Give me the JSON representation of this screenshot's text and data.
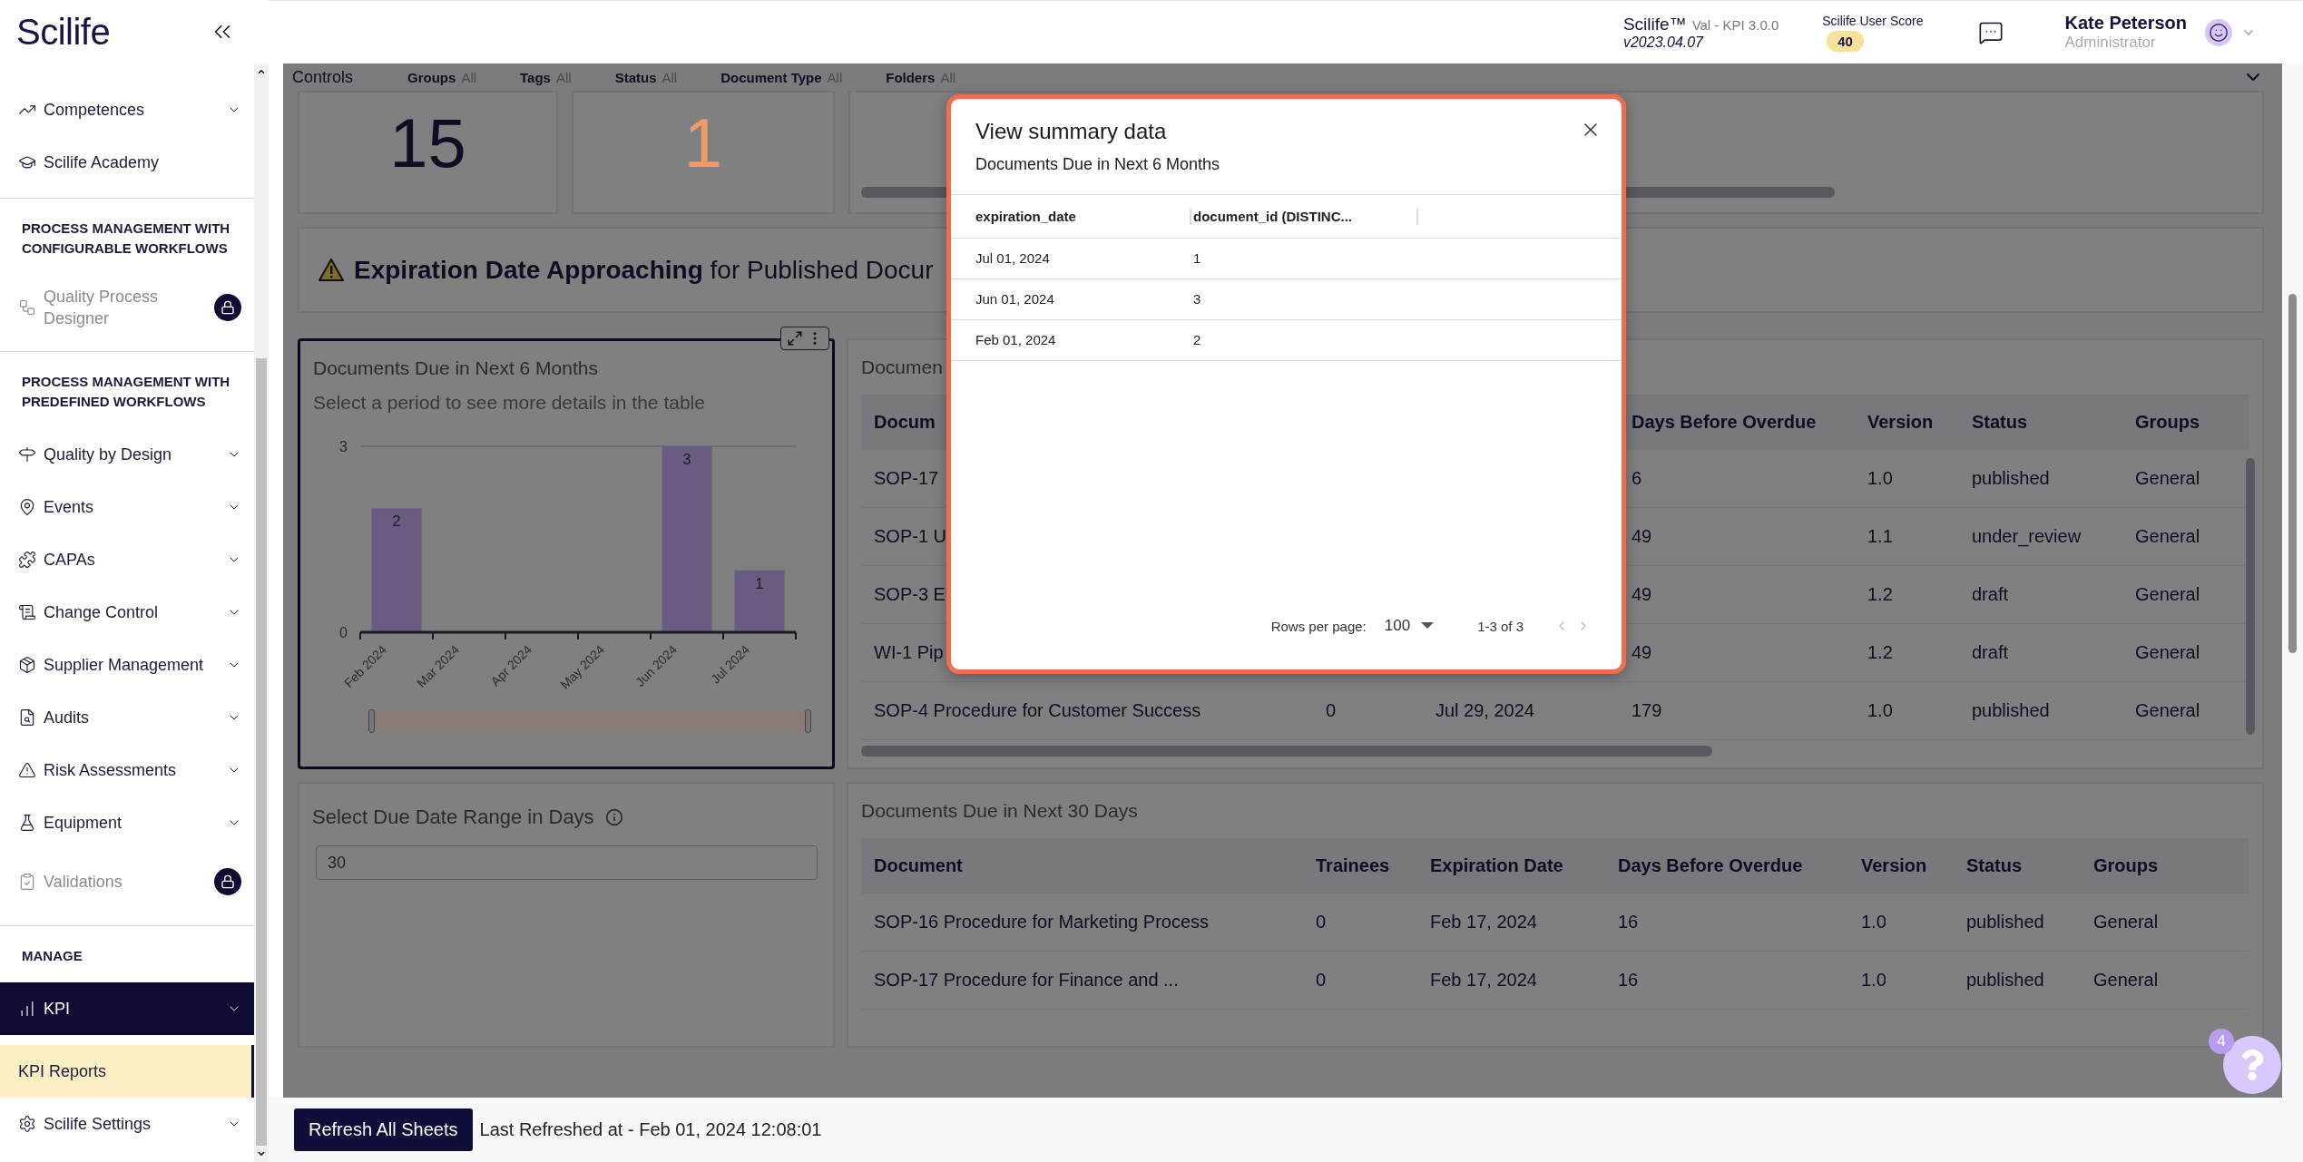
{
  "sidebar": {
    "logo": "Scilife",
    "groups": [
      {
        "items": [
          {
            "label": "Competences",
            "kind": "item",
            "selected": false,
            "expandable": true
          },
          {
            "label": "Scilife Academy",
            "kind": "item",
            "selected": false,
            "expandable": false
          }
        ]
      },
      {
        "heading": "PROCESS MANAGEMENT WITH CONFIGURABLE WORKFLOWS",
        "items": [
          {
            "label": "Quality Process Designer",
            "kind": "locked",
            "selected": false,
            "expandable": false
          }
        ]
      },
      {
        "heading": "PROCESS MANAGEMENT WITH PREDEFINED WORKFLOWS",
        "items": [
          {
            "label": "Quality by Design",
            "kind": "item",
            "selected": false,
            "expandable": true
          },
          {
            "label": "Events",
            "kind": "item",
            "selected": false,
            "expandable": true
          },
          {
            "label": "CAPAs",
            "kind": "item",
            "selected": false,
            "expandable": true
          },
          {
            "label": "Change Control",
            "kind": "item",
            "selected": false,
            "expandable": true
          },
          {
            "label": "Supplier Management",
            "kind": "item",
            "selected": false,
            "expandable": true
          },
          {
            "label": "Audits",
            "kind": "item",
            "selected": false,
            "expandable": true
          },
          {
            "label": "Risk Assessments",
            "kind": "item",
            "selected": false,
            "expandable": true
          },
          {
            "label": "Equipment",
            "kind": "item",
            "selected": false,
            "expandable": true
          },
          {
            "label": "Validations",
            "kind": "locked",
            "selected": false,
            "expandable": false
          }
        ]
      },
      {
        "heading": "MANAGE",
        "items": [
          {
            "label": "KPI",
            "kind": "item",
            "selected": true,
            "expandable": true
          },
          {
            "label": "KPI Reports",
            "kind": "sub",
            "selected": true,
            "expandable": false
          },
          {
            "label": "Scilife Settings",
            "kind": "item",
            "selected": false,
            "expandable": true
          }
        ]
      }
    ]
  },
  "header": {
    "product": "Scilife™",
    "edition": "Val - KPI 3.0.0",
    "version": "v2023.04.07",
    "score_label": "Scilife User Score",
    "score": "40",
    "user_name": "Kate Peterson",
    "user_role": "Administrator"
  },
  "controls": {
    "title": "Controls",
    "filters": [
      {
        "label": "Groups",
        "value": "All"
      },
      {
        "label": "Tags",
        "value": "All"
      },
      {
        "label": "Status",
        "value": "All"
      },
      {
        "label": "Document Type",
        "value": "All"
      },
      {
        "label": "Folders",
        "value": "All"
      }
    ]
  },
  "kpi_cards": [
    {
      "kind": "number",
      "value": "15",
      "color": "#0e0d24"
    },
    {
      "kind": "number",
      "value": "1",
      "color": "#f09a66"
    },
    {
      "kind": "scroll"
    }
  ],
  "banner": {
    "text": "**Expiration Date Approaching** for Published Docur"
  },
  "chart_card": {
    "title": "Documents Due in Next 6 Months",
    "subtitle": "Select a period to see more details in the table",
    "focused": true,
    "chart_data": {
      "type": "bar",
      "categories": [
        "Feb 2024",
        "Mar 2024",
        "Apr 2024",
        "May 2024",
        "Jun 2024",
        "Jul 2024"
      ],
      "series": [
        {
          "color": "#6a5c80",
          "values": [
            2,
            0,
            0,
            0,
            3,
            1
          ]
        }
      ],
      "ylim": [
        0,
        3
      ],
      "yticks": [
        0,
        3
      ],
      "value_labels": [
        "2",
        null,
        null,
        null,
        "3",
        "1"
      ]
    }
  },
  "range_card": {
    "title": "Select Due Date Range in Days",
    "value": "30"
  },
  "tables": [
    {
      "title": "Documen",
      "columns": [
        "Docum",
        null,
        null,
        "Days Before Overdue",
        "Version",
        "Status",
        "Groups"
      ],
      "rows": [
        [
          "SOP-17",
          null,
          null,
          "6",
          "1.0",
          "published",
          "General"
        ],
        [
          "SOP-1 U",
          null,
          null,
          "49",
          "1.1",
          "under_review",
          "General"
        ],
        [
          "SOP-3 E",
          null,
          null,
          "49",
          "1.2",
          "draft",
          "General"
        ],
        [
          "WI-1 Pip",
          null,
          null,
          "49",
          "1.2",
          "draft",
          "General"
        ],
        [
          "SOP-4 Procedure for Customer Success",
          "0",
          "Jul 29, 2024",
          "179",
          "1.0",
          "published",
          "General"
        ]
      ]
    },
    {
      "title": "Documents Due in Next 30 Days",
      "columns": [
        "Document",
        "Trainees",
        "Expiration Date",
        "Days Before Overdue",
        "Version",
        "Status",
        "Groups"
      ],
      "rows": [
        [
          "SOP-16 Procedure for Marketing Process",
          "0",
          "Feb 17, 2024",
          "16",
          "1.0",
          "published",
          "General"
        ],
        [
          "SOP-17 Procedure for Finance and ...",
          "0",
          "Feb 17, 2024",
          "16",
          "1.0",
          "published",
          "General"
        ]
      ]
    }
  ],
  "footer": {
    "button": "Refresh All Sheets",
    "status": "Last Refreshed at - Feb 01, 2024 12:08:01"
  },
  "help": {
    "badge": "4"
  },
  "modal": {
    "title": "View summary data",
    "subtitle": "Documents Due in Next 6 Months",
    "columns": [
      "expiration_date",
      "document_id (DISTINC..."
    ],
    "rows": [
      [
        "Jul 01, 2024",
        "1"
      ],
      [
        "Jun 01, 2024",
        "3"
      ],
      [
        "Feb 01, 2024",
        "2"
      ]
    ],
    "rows_per_page_label": "Rows per page:",
    "rows_per_page": "100",
    "range": "1-3 of 3"
  }
}
